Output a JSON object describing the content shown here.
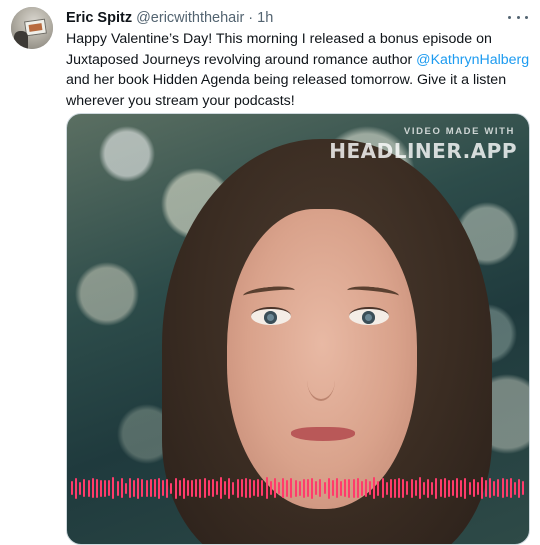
{
  "tweet": {
    "author_name": "Eric Spitz",
    "author_handle": "@ericwiththehair",
    "separator": "·",
    "timestamp": "1h",
    "text_before": "Happy Valentine’s Day! This morning I released a bonus episode on Juxtaposed Journeys revolving around romance author ",
    "mention": "@KathrynHalberg",
    "text_after": " and her book Hidden Agenda being released tomorrow. Give it a listen wherever you stream your podcasts!"
  },
  "media": {
    "watermark_top": "VIDEO MADE WITH",
    "watermark_main": "HEADLINER.APP",
    "waveform_color": "#ff3b6b"
  },
  "icons": {
    "more": "more-horizontal-icon"
  }
}
